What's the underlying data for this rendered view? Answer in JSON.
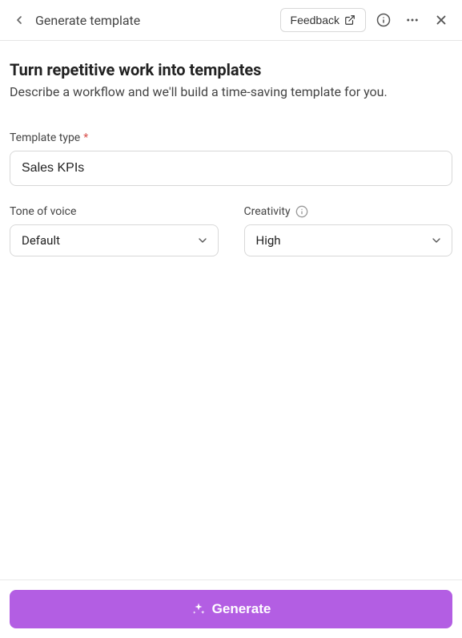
{
  "header": {
    "title": "Generate template",
    "feedback_label": "Feedback"
  },
  "main": {
    "heading": "Turn repetitive work into templates",
    "subheading": "Describe a workflow and we'll build a time-saving template for you.",
    "template_type": {
      "label": "Template type",
      "value": "Sales KPIs"
    },
    "tone": {
      "label": "Tone of voice",
      "value": "Default"
    },
    "creativity": {
      "label": "Creativity",
      "value": "High"
    }
  },
  "footer": {
    "generate_label": "Generate"
  }
}
